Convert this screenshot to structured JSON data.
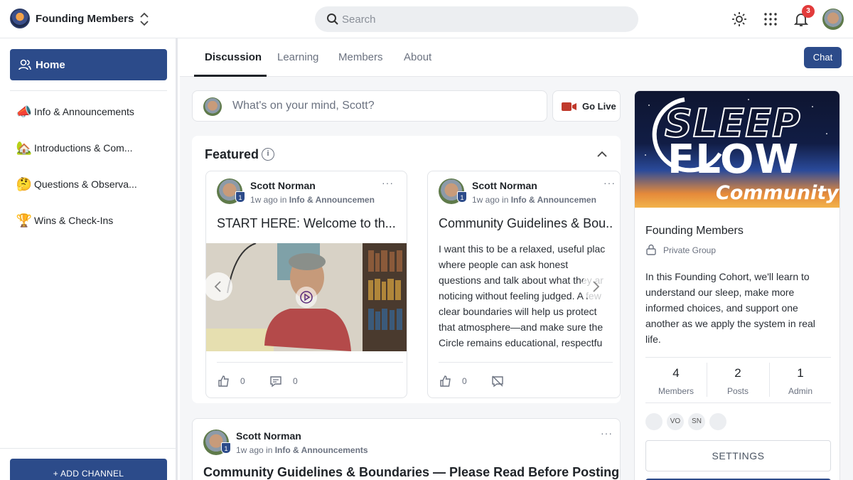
{
  "workspace": {
    "name": "Founding Members"
  },
  "search": {
    "placeholder": "Search"
  },
  "notifications": {
    "count": "3"
  },
  "sidebar": {
    "home_label": "Home",
    "channels": [
      {
        "emoji": "📣",
        "label": "Info & Announcements"
      },
      {
        "emoji": "🏡",
        "label": "Introductions & Com..."
      },
      {
        "emoji": "🤔",
        "label": "Questions & Observa..."
      },
      {
        "emoji": "🏆",
        "label": "Wins & Check-Ins"
      }
    ],
    "add_channel_label": "+ ADD CHANNEL"
  },
  "tabs": [
    "Discussion",
    "Learning",
    "Members",
    "About"
  ],
  "chat_label": "Chat",
  "composer": {
    "placeholder": "What's on your mind, Scott?",
    "go_live_label": "Go Live"
  },
  "featured": {
    "title": "Featured",
    "cards": [
      {
        "author": "Scott Norman",
        "level": "1",
        "time": "1w ago in",
        "channel": "Info & Announcemen",
        "title": "START HERE: Welcome to th...",
        "likes": "0",
        "comments": "0"
      },
      {
        "author": "Scott Norman",
        "level": "1",
        "time": "1w ago in",
        "channel": "Info & Announcemen",
        "title": "Community Guidelines & Bou...",
        "body": [
          "I want this to be a relaxed, useful plac",
          "where people can ask honest",
          "questions and talk about what they ar",
          "noticing without feeling judged. A few",
          "clear boundaries will help us protect",
          "that atmosphere—and make sure the",
          "Circle remains educational, respectfu"
        ],
        "likes": "0"
      }
    ]
  },
  "post": {
    "author": "Scott Norman",
    "level": "1",
    "time": "1w ago in",
    "channel": "Info & Announcements",
    "title": "Community Guidelines & Boundaries — Please Read Before Posting"
  },
  "group": {
    "banner_line1": "SLEEP",
    "banner_line2": "FLOW",
    "banner_line3": "Community",
    "name": "Founding Members",
    "privacy": "Private Group",
    "description": "In this Founding Cohort, we'll learn to understand our sleep, make more informed choices, and support one another as we apply the system in real life.",
    "stats": [
      {
        "value": "4",
        "label": "Members"
      },
      {
        "value": "2",
        "label": "Posts"
      },
      {
        "value": "1",
        "label": "Admin"
      }
    ],
    "member_initials": [
      "VO",
      "SN"
    ],
    "settings_label": "SETTINGS"
  },
  "colors": {
    "primary": "#2c4b8a",
    "badge": "#e23b3b",
    "live": "#c0392b"
  }
}
